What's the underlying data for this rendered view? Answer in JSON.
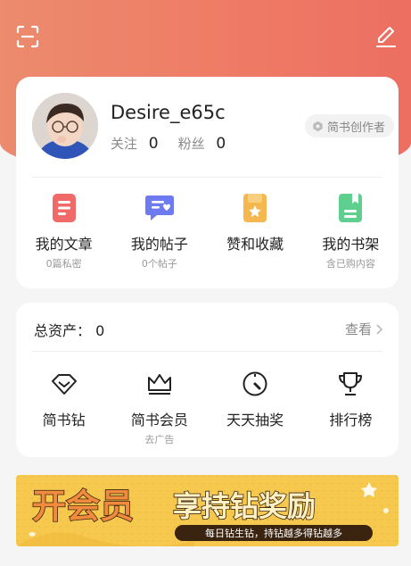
{
  "profile": {
    "username": "Desire_e65c",
    "following_label": "关注",
    "following_count": "0",
    "followers_label": "粉丝",
    "followers_count": "0",
    "creator_badge": "简书创作者"
  },
  "quick_links": [
    {
      "label": "我的文章",
      "sub": "0篇私密",
      "icon": "article-icon",
      "color": "#f06a6a"
    },
    {
      "label": "我的帖子",
      "sub": "0个帖子",
      "icon": "post-icon",
      "color": "#6e7af0"
    },
    {
      "label": "赞和收藏",
      "sub": "",
      "icon": "favorite-icon",
      "color": "#f5b84f"
    },
    {
      "label": "我的书架",
      "sub": "含已购内容",
      "icon": "bookshelf-icon",
      "color": "#5fcf8f"
    }
  ],
  "assets": {
    "label": "总资产：",
    "value": "0",
    "view_label": "查看"
  },
  "services": [
    {
      "label": "简书钻",
      "sub": "",
      "icon": "diamond-icon"
    },
    {
      "label": "简书会员",
      "sub": "去广告",
      "icon": "crown-icon"
    },
    {
      "label": "天天抽奖",
      "sub": "",
      "icon": "lottery-dial-icon"
    },
    {
      "label": "排行榜",
      "sub": "",
      "icon": "trophy-icon"
    }
  ],
  "banner": {
    "headline_left": "开会员",
    "headline_right": "享持钻奖励",
    "tagline": "每日钻生钻，持钻越多得钻越多"
  }
}
